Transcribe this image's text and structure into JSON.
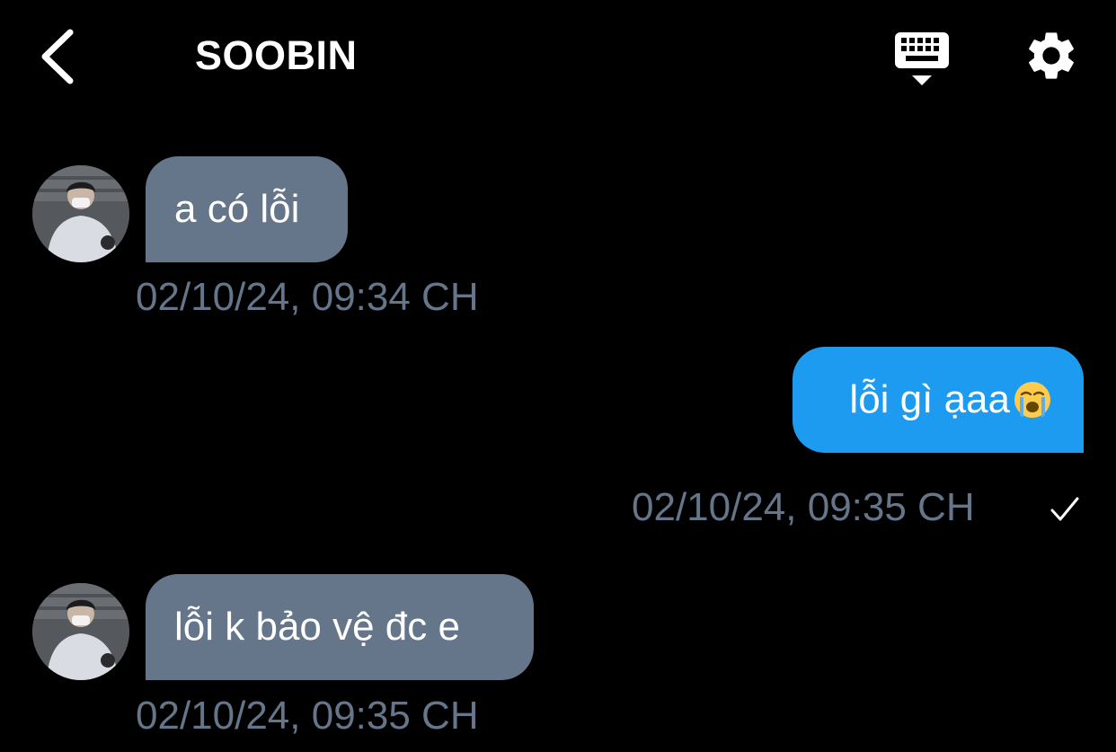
{
  "header": {
    "title": "SOOBIN",
    "back_icon": "chevron-left-icon",
    "keyboard_icon": "keyboard-icon",
    "settings_icon": "gear-icon"
  },
  "messages": [
    {
      "direction": "incoming",
      "text": "a có lỗi",
      "timestamp": "02/10/24, 09:34 CH"
    },
    {
      "direction": "outgoing",
      "text": "lỗi gì ạaa",
      "emoji": "loudly-crying-face-icon",
      "timestamp": "02/10/24, 09:35 CH",
      "status_icon": "checkmark-icon"
    },
    {
      "direction": "incoming",
      "text": "lỗi k bảo vệ đc e",
      "timestamp": "02/10/24, 09:35 CH"
    }
  ],
  "colors": {
    "background": "#000000",
    "incoming_bubble": "#65758A",
    "outgoing_bubble": "#1D9BF0",
    "timestamp": "#65758A",
    "text": "#FFFFFF"
  }
}
